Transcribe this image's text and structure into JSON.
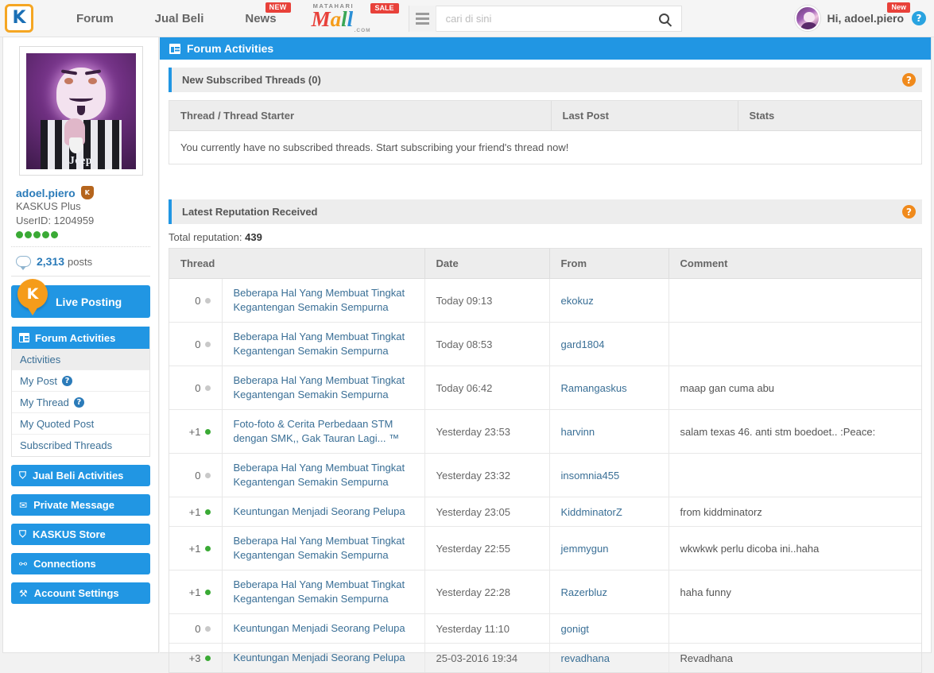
{
  "topnav": {
    "logo_text": "K",
    "logo_name": "kaskus-logo",
    "links": [
      {
        "label": "Forum",
        "badge": ""
      },
      {
        "label": "Jual Beli",
        "badge": ""
      },
      {
        "label": "News",
        "badge": "NEW"
      }
    ],
    "mall": {
      "top": "MATAHARI",
      "letters": [
        "M",
        "a",
        "l",
        "l",
        ""
      ],
      "word": "Mall",
      "com": ".COM",
      "badge": "SALE"
    },
    "search": {
      "placeholder": "cari di sini",
      "value": "",
      "icon": "search-icon",
      "menu_icon": "hamburger-icon"
    },
    "user": {
      "greeting": "Hi, adoel.piero",
      "badge": "New",
      "help_icon": "question-mark-icon",
      "help_label": "?"
    }
  },
  "sidebar": {
    "profile": {
      "username": "adoel.piero",
      "badge_icon": "shield-icon",
      "badge_label": "K",
      "rank": "KASKUS Plus",
      "userid": "UserID: 1204959",
      "reputation_dots": 5,
      "posts_count": "2,313",
      "posts_label": "posts"
    },
    "live_posting": {
      "label": "Live Posting",
      "icon": "kaskus-pin-icon",
      "icon_label": "K"
    },
    "menu": {
      "head": "Forum Activities",
      "items": [
        {
          "label": "Activities",
          "help": false,
          "active": true
        },
        {
          "label": "My Post",
          "help": true,
          "active": false
        },
        {
          "label": "My Thread",
          "help": true,
          "active": false
        },
        {
          "label": "My Quoted Post",
          "help": false,
          "active": false
        },
        {
          "label": "Subscribed Threads",
          "help": false,
          "active": false
        }
      ]
    },
    "buttons": [
      {
        "label": "Jual Beli Activities",
        "icon": "cart-icon",
        "glyph": "⛉"
      },
      {
        "label": "Private Message",
        "icon": "envelope-icon",
        "glyph": "✉"
      },
      {
        "label": "KASKUS Store",
        "icon": "cart-icon",
        "glyph": "⛉"
      },
      {
        "label": "Connections",
        "icon": "people-icon",
        "glyph": "⚯"
      },
      {
        "label": "Account Settings",
        "icon": "wrench-icon",
        "glyph": "⚒"
      }
    ]
  },
  "main": {
    "title": "Forum Activities",
    "title_icon": "window-icon",
    "subscribed": {
      "heading": "New Subscribed Threads (0)",
      "help_label": "?",
      "columns": [
        "Thread / Thread Starter",
        "Last Post",
        "Stats"
      ],
      "empty_message": "You currently have no subscribed threads. Start subscribing your friend's thread now!"
    },
    "reputation": {
      "heading": "Latest Reputation Received",
      "help_label": "?",
      "total_label": "Total reputation:",
      "total_value": "439",
      "columns": [
        "Thread",
        "Date",
        "From",
        "Comment"
      ],
      "rows": [
        {
          "points": "0",
          "sign": "zero",
          "thread": "Beberapa Hal Yang Membuat Tingkat Kegantengan Semakin Sempurna",
          "date": "Today 09:13",
          "from": "ekokuz",
          "comment": ""
        },
        {
          "points": "0",
          "sign": "zero",
          "thread": "Beberapa Hal Yang Membuat Tingkat Kegantengan Semakin Sempurna",
          "date": "Today 08:53",
          "from": "gard1804",
          "comment": ""
        },
        {
          "points": "0",
          "sign": "zero",
          "thread": "Beberapa Hal Yang Membuat Tingkat Kegantengan Semakin Sempurna",
          "date": "Today 06:42",
          "from": "Ramangaskus",
          "comment": "maap gan cuma abu"
        },
        {
          "points": "+1",
          "sign": "pos",
          "thread": "Foto-foto & Cerita Perbedaan STM dengan SMK,, Gak Tauran Lagi... ™",
          "date": "Yesterday 23:53",
          "from": "harvinn",
          "comment": "salam texas 46. anti stm boedoet.. :Peace:"
        },
        {
          "points": "0",
          "sign": "zero",
          "thread": "Beberapa Hal Yang Membuat Tingkat Kegantengan Semakin Sempurna",
          "date": "Yesterday 23:32",
          "from": "insomnia455",
          "comment": ""
        },
        {
          "points": "+1",
          "sign": "pos",
          "thread": "Keuntungan Menjadi Seorang Pelupa",
          "date": "Yesterday 23:05",
          "from": "KiddminatorZ",
          "comment": "from kiddminatorz"
        },
        {
          "points": "+1",
          "sign": "pos",
          "thread": "Beberapa Hal Yang Membuat Tingkat Kegantengan Semakin Sempurna",
          "date": "Yesterday 22:55",
          "from": "jemmygun",
          "comment": "wkwkwk perlu dicoba ini..haha"
        },
        {
          "points": "+1",
          "sign": "pos",
          "thread": "Beberapa Hal Yang Membuat Tingkat Kegantengan Semakin Sempurna",
          "date": "Yesterday 22:28",
          "from": "Razerbluz",
          "comment": "haha funny"
        },
        {
          "points": "0",
          "sign": "zero",
          "thread": "Keuntungan Menjadi Seorang Pelupa",
          "date": "Yesterday 11:10",
          "from": "gonigt",
          "comment": ""
        },
        {
          "points": "+3",
          "sign": "pos",
          "thread": "Keuntungan Menjadi Seorang Pelupa",
          "date": "25-03-2016 19:34",
          "from": "revadhana",
          "comment": "Revadhana"
        }
      ]
    }
  },
  "colors": {
    "brand_blue": "#2196e3",
    "accent_orange": "#f08a1c",
    "link_blue": "#3a6f96",
    "badge_red": "#e8413a",
    "positive_green": "#3aaa35"
  }
}
